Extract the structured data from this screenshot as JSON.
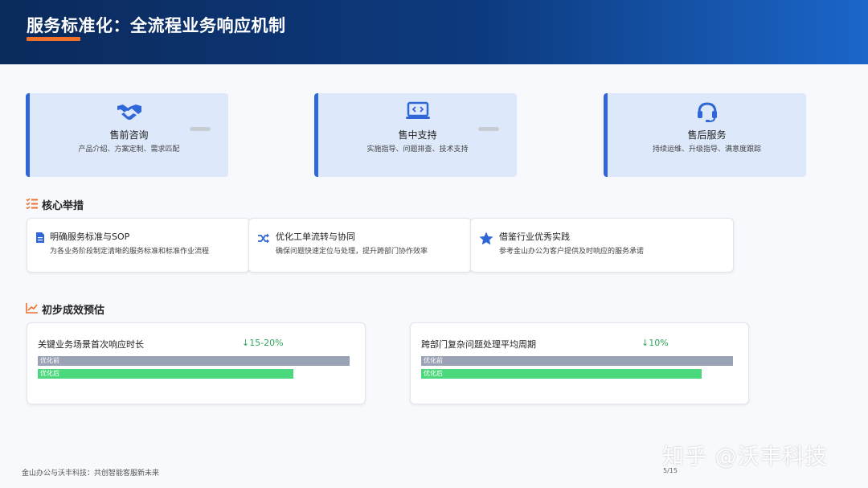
{
  "header": {
    "title": "服务标准化：全流程业务响应机制"
  },
  "stages": [
    {
      "name": "售前咨询",
      "desc": "产品介绍、方案定制、需求匹配",
      "icon": "handshake-icon"
    },
    {
      "name": "售中支持",
      "desc": "实施指导、问题排查、技术支持",
      "icon": "laptop-code-icon"
    },
    {
      "name": "售后服务",
      "desc": "持续运维、升级指导、满意度跟踪",
      "icon": "headset-icon"
    }
  ],
  "measures_section": {
    "title": "核心举措",
    "icon": "checklist-icon"
  },
  "measures": [
    {
      "title": "明确服务标准与SOP",
      "desc": "为各业务阶段制定清晰的服务标准和标准作业流程",
      "icon": "document-icon"
    },
    {
      "title": "优化工单流转与协同",
      "desc": "确保问题快速定位与处理，提升跨部门协作效率",
      "icon": "shuffle-icon"
    },
    {
      "title": "借鉴行业优秀实践",
      "desc": "参考金山办公为客户提供及时响应的服务承诺",
      "icon": "star-icon"
    }
  ],
  "results_section": {
    "title": "初步成效预估",
    "icon": "chart-line-icon"
  },
  "results": [
    {
      "title": "关键业务场景首次响应时长",
      "change": "↓15-20%",
      "before_label": "优化前",
      "after_label": "优化后",
      "before": 1.0,
      "after": 0.82
    },
    {
      "title": "跨部门复杂问题处理平均周期",
      "change": "↓10%",
      "before_label": "优化前",
      "after_label": "优化后",
      "before": 1.0,
      "after": 0.9
    }
  ],
  "footer": {
    "left": "金山办公与沃丰科技：共创智能客服新未来",
    "page": "5/15"
  },
  "watermark": "知乎 @沃丰科技",
  "colors": {
    "accent_blue": "#2f66d8",
    "header_dark": "#0b2a5c",
    "header_orange": "#f0702b",
    "bar_before": "#9aa3b5",
    "bar_after": "#4cd97e",
    "change_green": "#2fa65a"
  }
}
